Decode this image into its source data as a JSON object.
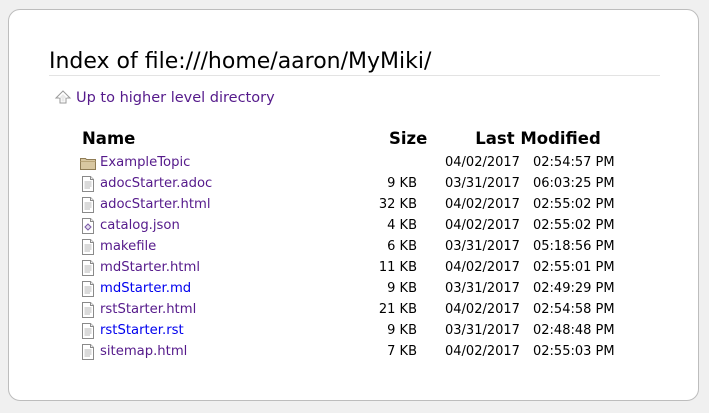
{
  "page": {
    "title": "Index of file:///home/aaron/MyMiki/",
    "up_link_label": "Up to higher level directory"
  },
  "table": {
    "headers": {
      "name": "Name",
      "size": "Size",
      "modified": "Last Modified"
    },
    "rows": [
      {
        "name": "ExampleTopic",
        "size": "",
        "date": "04/02/2017",
        "time": "02:54:57 PM",
        "icon": "folder-icon",
        "visited": true
      },
      {
        "name": "adocStarter.adoc",
        "size": "9 KB",
        "date": "03/31/2017",
        "time": "06:03:25 PM",
        "icon": "text-file-icon",
        "visited": true
      },
      {
        "name": "adocStarter.html",
        "size": "32 KB",
        "date": "04/02/2017",
        "time": "02:55:02 PM",
        "icon": "text-file-icon",
        "visited": true
      },
      {
        "name": "catalog.json",
        "size": "4 KB",
        "date": "04/02/2017",
        "time": "02:55:02 PM",
        "icon": "json-file-icon",
        "visited": true
      },
      {
        "name": "makefile",
        "size": "6 KB",
        "date": "03/31/2017",
        "time": "05:18:56 PM",
        "icon": "text-file-icon",
        "visited": true
      },
      {
        "name": "mdStarter.html",
        "size": "11 KB",
        "date": "04/02/2017",
        "time": "02:55:01 PM",
        "icon": "text-file-icon",
        "visited": true
      },
      {
        "name": "mdStarter.md",
        "size": "9 KB",
        "date": "03/31/2017",
        "time": "02:49:29 PM",
        "icon": "text-file-icon",
        "visited": false
      },
      {
        "name": "rstStarter.html",
        "size": "21 KB",
        "date": "04/02/2017",
        "time": "02:54:58 PM",
        "icon": "text-file-icon",
        "visited": true
      },
      {
        "name": "rstStarter.rst",
        "size": "9 KB",
        "date": "03/31/2017",
        "time": "02:48:48 PM",
        "icon": "text-file-icon",
        "visited": false
      },
      {
        "name": "sitemap.html",
        "size": "7 KB",
        "date": "04/02/2017",
        "time": "02:55:03 PM",
        "icon": "text-file-icon",
        "visited": true
      }
    ]
  },
  "colors": {
    "visited_link": "#551a8b",
    "unvisited_link": "#0000ee",
    "folder": "#c9b48a"
  }
}
